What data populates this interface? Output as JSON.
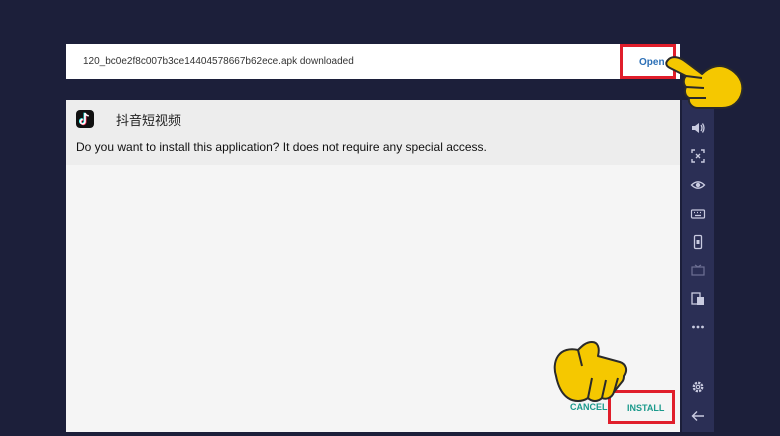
{
  "toast": {
    "filename_text": "120_bc0e2f8c007b3ce14404578667b62ece.apk downloaded",
    "open_label": "Open"
  },
  "dialog": {
    "app_name": "抖音短视频",
    "question": "Do you want to install this application? It does not require any special access.",
    "cancel_label": "CANCEL",
    "install_label": "INSTALL"
  },
  "sidebar": {
    "icons": [
      "volume-icon",
      "screenshot-icon",
      "eye-icon",
      "keyboard-icon",
      "phone-icon",
      "media-icon",
      "copy-icon",
      "more-icon",
      "settings-icon",
      "back-icon"
    ]
  },
  "colors": {
    "background": "#1c1f3a",
    "sidebar": "#2b2f55",
    "highlight": "#e01e2b",
    "button_text": "#1b9a8c",
    "link": "#2b6fb6",
    "pointer_hand": "#f5c800"
  }
}
